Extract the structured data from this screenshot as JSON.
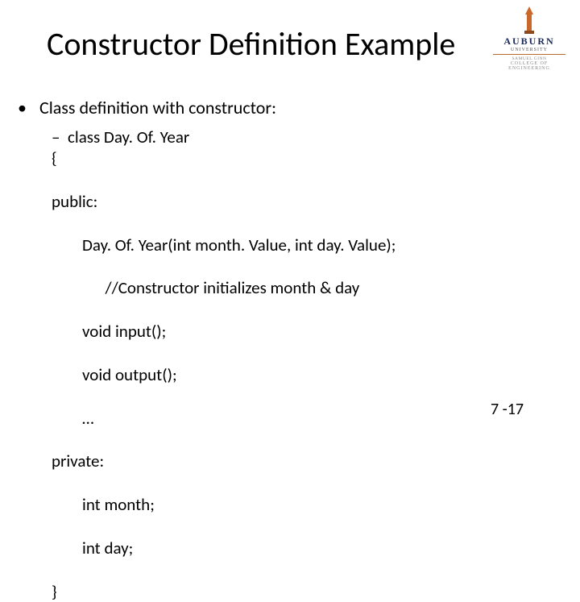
{
  "logo": {
    "auburn": "AUBURN",
    "university": "UNIVERSITY",
    "line1": "SAMUEL GINN",
    "line2": "COLLEGE OF ENGINEERING"
  },
  "title": "Constructor Definition Example",
  "bullet1": "Class definition with constructor:",
  "code_first": "class Day. Of. Year",
  "code": {
    "l1": "{",
    "l2": "public:",
    "l3": "Day. Of. Year(int month. Value, int day. Value);",
    "l4": "      //Constructor initializes month & day",
    "l5": "void input();",
    "l6": "void output();",
    "l7": "…",
    "l8": "private:",
    "l9": "int month;",
    "l10": "int day;",
    "l11": "}"
  },
  "slidenum": "7 -17"
}
